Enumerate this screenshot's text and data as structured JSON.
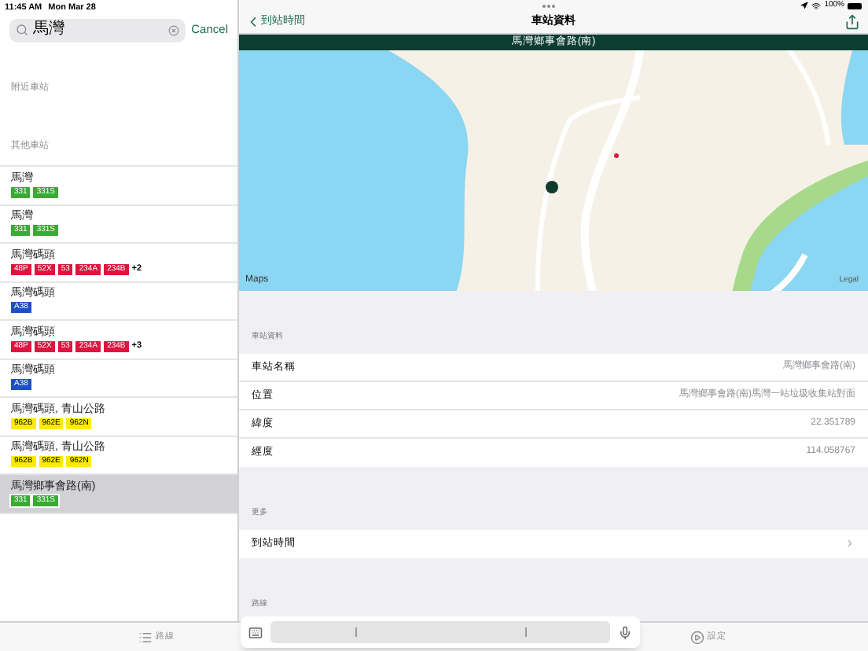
{
  "status_bar": {
    "time": "11:45 AM",
    "date": "Mon Mar 28",
    "battery": "100%"
  },
  "search": {
    "value": "馬灣",
    "cancel": "Cancel"
  },
  "sidebar": {
    "nearby_header": "附近車站",
    "other_header": "其他車站",
    "stops": [
      {
        "name": "馬灣",
        "selected": false,
        "routes": [
          {
            "label": "331",
            "color": "#3aaa35"
          },
          {
            "label": "331S",
            "color": "#3aaa35"
          }
        ]
      },
      {
        "name": "馬灣",
        "selected": false,
        "routes": [
          {
            "label": "331",
            "color": "#3aaa35"
          },
          {
            "label": "331S",
            "color": "#3aaa35"
          }
        ]
      },
      {
        "name": "馬灣碼頭",
        "selected": false,
        "routes": [
          {
            "label": "48P",
            "color": "#e0133f"
          },
          {
            "label": "52X",
            "color": "#e0133f"
          },
          {
            "label": "53",
            "color": "#e0133f"
          },
          {
            "label": "234A",
            "color": "#e0133f"
          },
          {
            "label": "234B",
            "color": "#e0133f"
          }
        ],
        "more": "+2"
      },
      {
        "name": "馬灣碼頭",
        "selected": false,
        "routes": [
          {
            "label": "A38",
            "color": "#1f4fc8"
          }
        ]
      },
      {
        "name": "馬灣碼頭",
        "selected": false,
        "routes": [
          {
            "label": "48P",
            "color": "#e0133f"
          },
          {
            "label": "52X",
            "color": "#e0133f"
          },
          {
            "label": "53",
            "color": "#e0133f"
          },
          {
            "label": "234A",
            "color": "#e0133f"
          },
          {
            "label": "234B",
            "color": "#e0133f"
          }
        ],
        "more": "+3"
      },
      {
        "name": "馬灣碼頭",
        "selected": false,
        "routes": [
          {
            "label": "A38",
            "color": "#1f4fc8"
          }
        ]
      },
      {
        "name": "馬灣碼頭, 青山公路",
        "selected": false,
        "routes": [
          {
            "label": "962B",
            "color": "#ffea00"
          },
          {
            "label": "962E",
            "color": "#ffea00"
          },
          {
            "label": "962N",
            "color": "#ffea00"
          }
        ]
      },
      {
        "name": "馬灣碼頭, 青山公路",
        "selected": false,
        "routes": [
          {
            "label": "962B",
            "color": "#ffea00"
          },
          {
            "label": "962E",
            "color": "#ffea00"
          },
          {
            "label": "962N",
            "color": "#ffea00"
          }
        ]
      },
      {
        "name": "馬灣鄉事會路(南)",
        "selected": true,
        "routes": [
          {
            "label": "331",
            "color": "#3aaa35"
          },
          {
            "label": "331S",
            "color": "#3aaa35"
          }
        ]
      }
    ]
  },
  "detail": {
    "back": "到站時間",
    "title": "車站資料",
    "banner": "馬灣鄉事會路(南)",
    "map": {
      "attribution": "Maps",
      "legal": "Legal"
    },
    "sections": [
      {
        "header": "車站資料",
        "rows": [
          {
            "kind": "info",
            "label": "車站名稱",
            "value": "馬灣鄉事會路(南)"
          },
          {
            "kind": "info",
            "label": "位置",
            "value": "馬灣鄉事會路(南)馬灣一站垃圾收集站對面"
          },
          {
            "kind": "info",
            "label": "緯度",
            "value": "22.351789"
          },
          {
            "kind": "info",
            "label": "經度",
            "value": "114.058767"
          }
        ]
      },
      {
        "header": "更多",
        "rows": [
          {
            "kind": "link",
            "label": "到站時間"
          }
        ]
      },
      {
        "header": "路線"
      }
    ]
  },
  "tab_bar": [
    {
      "kind": "list",
      "label": "路線"
    },
    {
      "kind": "play",
      "label": "設定"
    }
  ]
}
